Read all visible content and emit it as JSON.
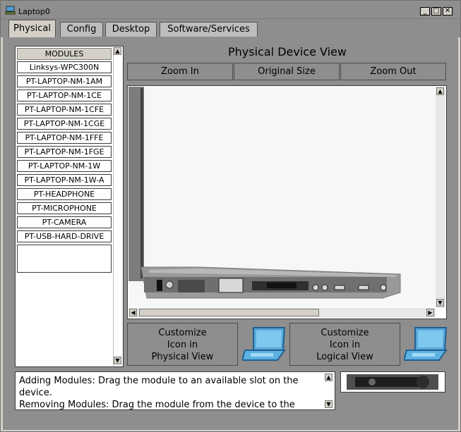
{
  "window": {
    "title": "Laptop0",
    "minimize": "_",
    "maximize": "□",
    "close": "✕"
  },
  "tabs": [
    {
      "label": "Physical",
      "active": true
    },
    {
      "label": "Config"
    },
    {
      "label": "Desktop"
    },
    {
      "label": "Software/Services"
    }
  ],
  "modules": {
    "header": "MODULES",
    "items": [
      "Linksys-WPC300N",
      "PT-LAPTOP-NM-1AM",
      "PT-LAPTOP-NM-1CE",
      "PT-LAPTOP-NM-1CFE",
      "PT-LAPTOP-NM-1CGE",
      "PT-LAPTOP-NM-1FFE",
      "PT-LAPTOP-NM-1FGE",
      "PT-LAPTOP-NM-1W",
      "PT-LAPTOP-NM-1W-A",
      "PT-HEADPHONE",
      "PT-MICROPHONE",
      "PT-CAMERA",
      "PT-USB-HARD-DRIVE"
    ]
  },
  "physical_view": {
    "title": "Physical Device View",
    "zoom_in": "Zoom In",
    "original_size": "Original Size",
    "zoom_out": "Zoom Out"
  },
  "customize": {
    "physical": [
      "Customize",
      "Icon in",
      "Physical View"
    ],
    "logical": [
      "Customize",
      "Icon in",
      "Logical View"
    ]
  },
  "info": {
    "line1": "Adding Modules: Drag the module to an available slot on the",
    "line2": " device.",
    "line3": "Removing Modules: Drag the module from the device to the"
  },
  "icons": {
    "app": "laptop-app-icon",
    "scroll_up": "▲",
    "scroll_down": "▼",
    "scroll_left": "◀",
    "scroll_right": "▶"
  },
  "colors": {
    "panel_gray": "#8e8e8e",
    "dialog_face": "#d4d0c8",
    "laptop_screen": "#58a8d8"
  }
}
